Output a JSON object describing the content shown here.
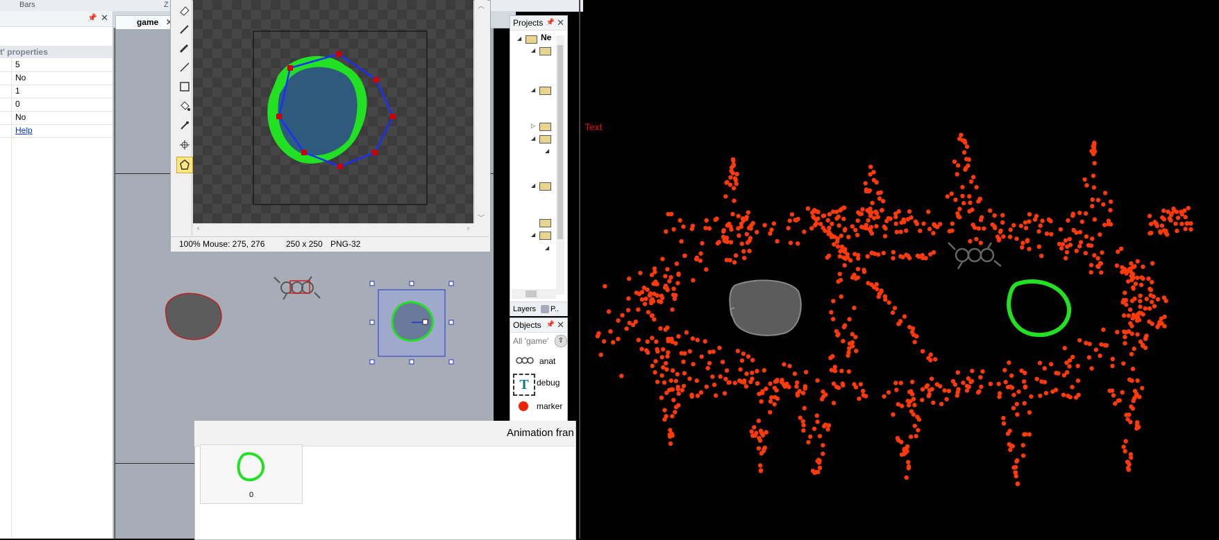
{
  "ribbon": {
    "item_bars": "Bars",
    "item_z": "Z"
  },
  "properties": {
    "section_title": "t' properties",
    "rows": [
      "5",
      "No",
      "1",
      "0",
      "No"
    ],
    "help_link": "Help"
  },
  "layout": {
    "tab_label": "game"
  },
  "image_editor": {
    "zoom": "100%",
    "mouse": "Mouse: 275, 276",
    "size": "250 x 250",
    "format": "PNG-32"
  },
  "projects_panel": {
    "title": "Projects",
    "root_label": "Ne",
    "tabs": [
      "Layers",
      "P.."
    ]
  },
  "objects_panel": {
    "title": "Objects",
    "filter": "All 'game'",
    "items": [
      "anat",
      "debug",
      "marker"
    ]
  },
  "animation": {
    "title": "Animation fran",
    "frame_index": "0"
  },
  "game_view": {
    "text_label": "Text"
  },
  "colors": {
    "accent_green": "#22e022",
    "marker_red": "#ff3a0a",
    "polygon_blue": "#1a2eff",
    "point_red": "#cc0000"
  }
}
